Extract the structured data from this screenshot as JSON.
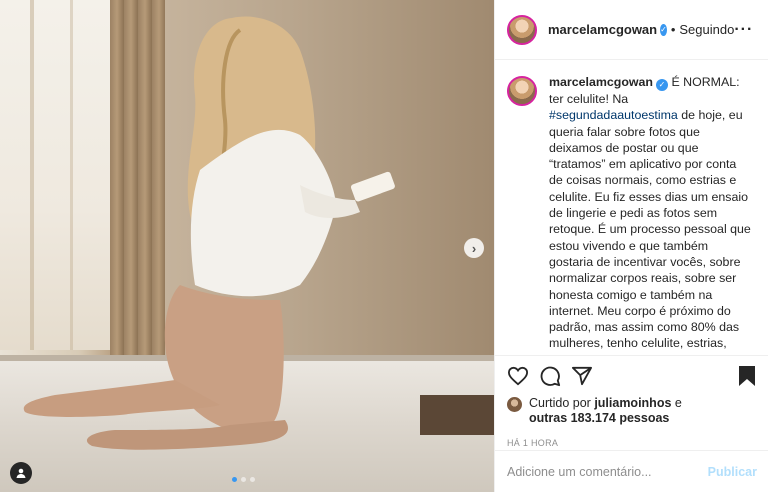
{
  "post": {
    "username": "marcelamcgowan",
    "separator": "•",
    "follow_status": "Seguindo",
    "more_icon": "more-horizontal-icon",
    "caption_username": "marcelamcgowan",
    "caption_part1": " É NORMAL: ter celulite! Na ",
    "caption_hashtag": "#segundadaautoestima",
    "caption_part2": " de hoje, eu queria falar sobre fotos que deixamos de postar ou que “tratamos” em aplicativo por conta de coisas normais, como estrias e celulite. Eu fiz esses dias um ensaio de lingerie e pedi as fotos sem retoque. É um processo pessoal que estou vivendo e que também gostaria de incentivar vocês, sobre normalizar corpos reais, sobre ser honesta comigo e também na internet. Meu corpo é próximo do padrão, mas assim como 80% das mulheres, tenho celulite, estrias, vasinhos, marcas, barriguinha, dobras e, apagar isso digitalmente só serve pra me distanciar da realidade do meu corpo e fazer outras mulheres",
    "liked_prefix": "Curtido por ",
    "liked_user": "juliamoinhos",
    "liked_suffix": " e",
    "liked_others": "outras 183.174 pessoas",
    "timestamp": "HÁ 1 HORA",
    "comment_placeholder": "Adicione um comentário...",
    "publish_label": "Publicar",
    "carousel": {
      "total": 3,
      "active": 1
    },
    "colors": {
      "accent": "#3897f0",
      "hashtag": "#00376b",
      "publish_disabled": "#b2dffc"
    }
  }
}
